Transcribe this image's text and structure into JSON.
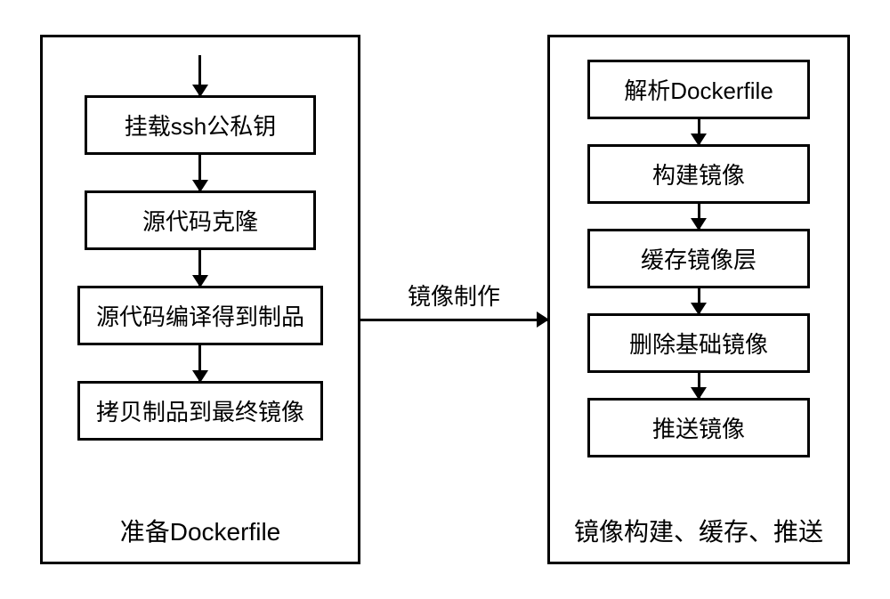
{
  "left_panel": {
    "label": "准备Dockerfile",
    "steps": [
      "挂载ssh公私钥",
      "源代码克隆",
      "源代码编译得到制品",
      "拷贝制品到最终镜像"
    ]
  },
  "connector": {
    "label": "镜像制作"
  },
  "right_panel": {
    "label": "镜像构建、缓存、推送",
    "steps": [
      "解析Dockerfile",
      "构建镜像",
      "缓存镜像层",
      "删除基础镜像",
      "推送镜像"
    ]
  }
}
